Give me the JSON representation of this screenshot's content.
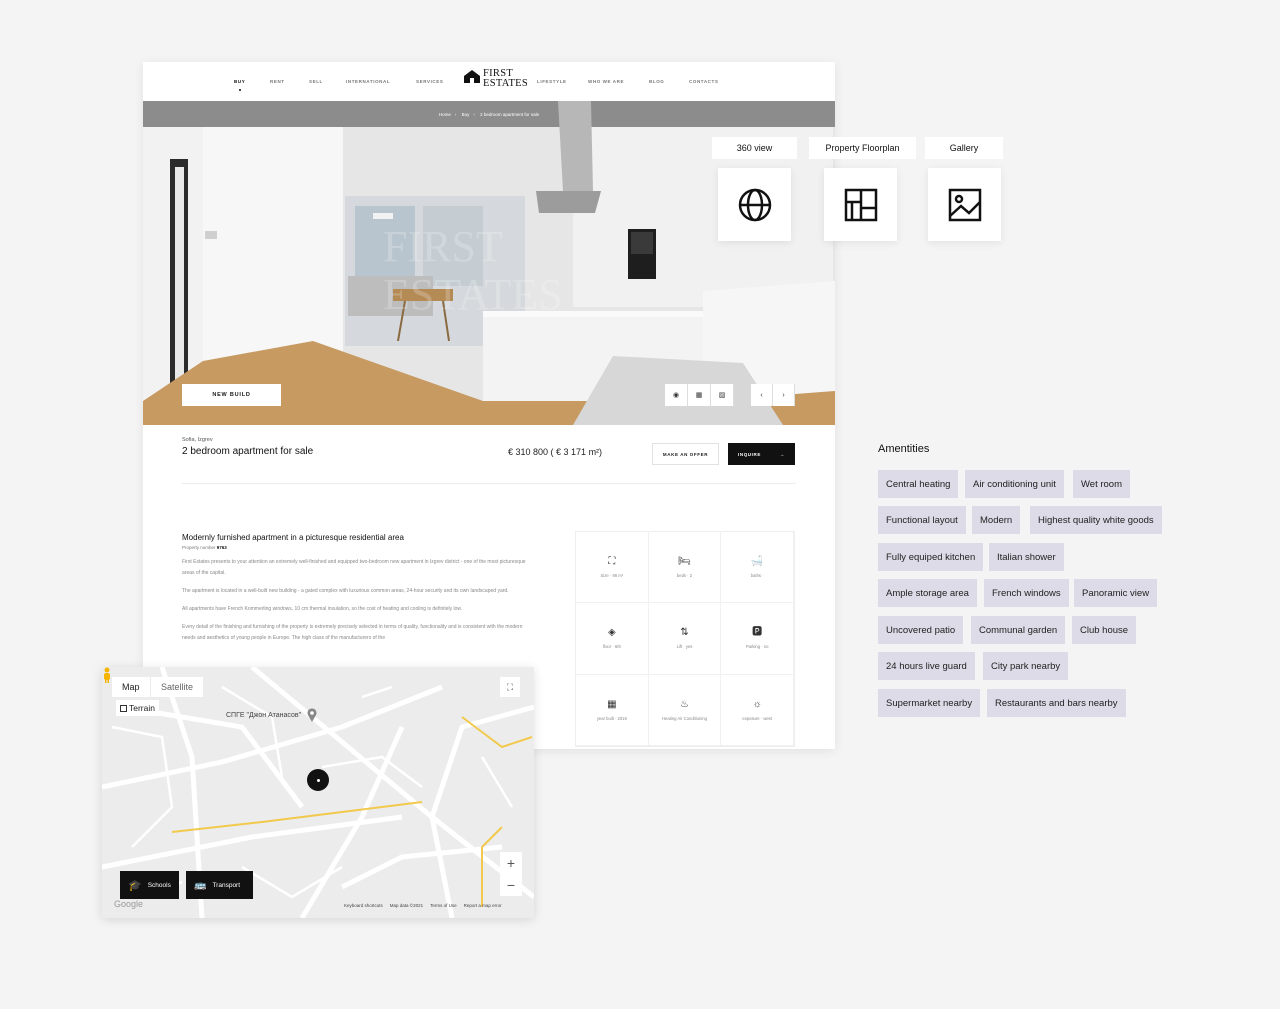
{
  "nav": {
    "items": [
      "BUY",
      "RENT",
      "SELL",
      "INTERNATIONAL",
      "SERVICES",
      "LIFESTYLE",
      "WHO WE ARE",
      "BLOG",
      "CONTACTS"
    ],
    "active": "BUY",
    "logo_line1": "FIRST",
    "logo_line2": "ESTATES"
  },
  "breadcrumb": [
    "Home",
    "Buy",
    "2 bedroom apartment for sale"
  ],
  "hero": {
    "badge": "NEW BUILD",
    "watermark_line1": "FIRST",
    "watermark_line2": "ESTATES"
  },
  "listing": {
    "location": "Sofia, Izgrev",
    "title": "2 bedroom apartment for sale",
    "price": "€ 310 800 ( € 3 171 m²)",
    "offer_label": "MAKE AN OFFER",
    "inquire_label": "INQUIRE"
  },
  "description": {
    "heading": "Modernly furnished apartment in a picturesque residential area",
    "property_label": "Property number",
    "property_number": "9763",
    "paragraphs": [
      "First Estates presents to your attention an extremely well-finished and equipped two-bedroom new apartment in Izgrev district - one of the most picturesque areas of the capital.",
      "The apartment is located in a well-built new building - a gated complex with luxurious common areas, 24-hour security and its own landscaped yard.",
      "All apartments have French Kommerling windows, 10 cm thermal insulation, so the cost of heating and cooling is definitely low.",
      "Every detail of the finishing and furnishing of the property is extremely precisely selected in terms of quality, functionality and is consistent with the modern needs and aesthetics of young people in Europe. The high class of the manufacturers of the"
    ]
  },
  "features": [
    {
      "icon": "size-icon",
      "glyph": "⛶",
      "label": "Size · 98 m²"
    },
    {
      "icon": "bed-icon",
      "glyph": "🛏",
      "label": "beds · 2"
    },
    {
      "icon": "bath-icon",
      "glyph": "🛁",
      "label": "baths ·"
    },
    {
      "icon": "floor-icon",
      "glyph": "◈",
      "label": "floor · 6/8"
    },
    {
      "icon": "lift-icon",
      "glyph": "⇅",
      "label": "Lift · yes"
    },
    {
      "icon": "parking-icon",
      "glyph": "🅿",
      "label": "Parking · no"
    },
    {
      "icon": "calendar-icon",
      "glyph": "▦",
      "label": "year built · 2019"
    },
    {
      "icon": "heating-icon",
      "glyph": "♨",
      "label": "Heating Air Conditioning"
    },
    {
      "icon": "sun-icon",
      "glyph": "☼",
      "label": "exposure · west"
    }
  ],
  "views": [
    {
      "label": "360 view",
      "icon": "globe-icon"
    },
    {
      "label": "Property Floorplan",
      "icon": "floorplan-icon"
    },
    {
      "label": "Gallery",
      "icon": "image-icon"
    }
  ],
  "amenities": {
    "title": "Amentities",
    "tags": [
      "Central heating",
      "Air conditioning unit",
      "Wet room",
      "Functional layout",
      "Modern",
      "Highest quality white goods",
      "Fully equiped kitchen",
      "Italian shower",
      "Ample storage area",
      "French windows",
      "Panoramic view",
      "Uncovered patio",
      "Communal garden",
      "Club house",
      "24 hours live guard",
      "City park nearby",
      "Supermarket nearby",
      "Restaurants and bars nearby"
    ]
  },
  "map": {
    "tab_map": "Map",
    "tab_satellite": "Satellite",
    "terrain": "Terrain",
    "poi_label": "СПГЕ \"Джон Атанасов\"",
    "schools_label": "Schools",
    "transport_label": "Transport",
    "footer": [
      "Keyboard shortcuts",
      "Map data ©2021",
      "Terms of Use",
      "Report a map error"
    ],
    "google": "Google"
  },
  "colors": {
    "accent": "#111111",
    "tag_bg": "#dcdbe7",
    "page_bg": "#f4f4f4"
  }
}
